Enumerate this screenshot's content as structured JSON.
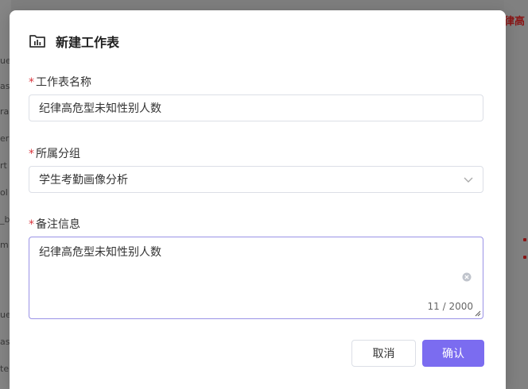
{
  "background": {
    "left_fragments": [
      "ue",
      "as",
      "ra",
      "er",
      "rt",
      "ol",
      "_b",
      "m",
      "ue",
      "as",
      "te"
    ],
    "right_fragment": "律高"
  },
  "dialog": {
    "title": "新建工作表",
    "title_icon": "folder-chart-icon",
    "fields": {
      "name": {
        "label": "工作表名称",
        "value": "纪律高危型未知性别人数"
      },
      "group": {
        "label": "所属分组",
        "value": "学生考勤画像分析"
      },
      "remark": {
        "label": "备注信息",
        "value": "纪律高危型未知性别人数",
        "counter": "11 / 2000"
      }
    },
    "buttons": {
      "cancel": "取消",
      "confirm": "确认"
    }
  },
  "colors": {
    "primary": "#7b6cf0",
    "required": "#d9363e",
    "focus_border": "#9a93e6"
  }
}
